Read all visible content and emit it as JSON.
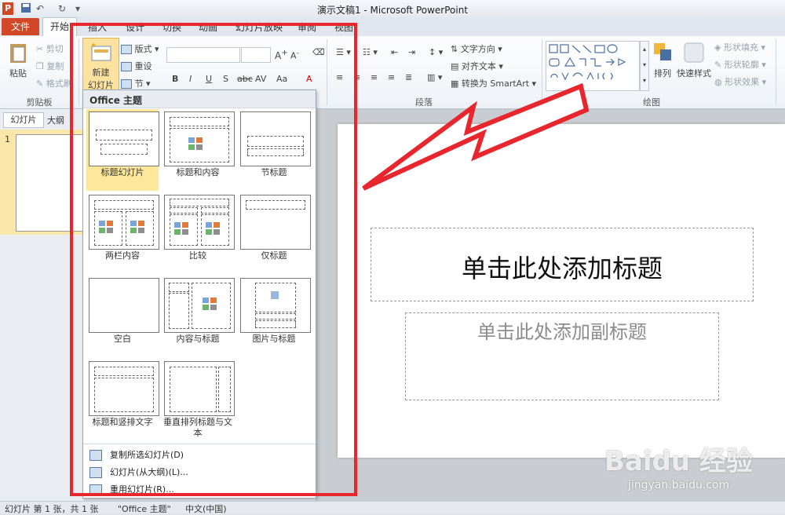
{
  "window": {
    "title": "演示文稿1 - Microsoft PowerPoint"
  },
  "tabs": [
    "文件",
    "开始",
    "插入",
    "设计",
    "切换",
    "动画",
    "幻灯片放映",
    "审阅",
    "视图"
  ],
  "ribbon": {
    "clipboard": {
      "paste": "粘贴",
      "cut": "剪切",
      "copy": "复制",
      "format_painter": "格式刷",
      "label": "剪贴板"
    },
    "slides": {
      "new_slide_line1": "新建",
      "new_slide_line2": "幻灯片",
      "layout": "版式",
      "reset": "重设",
      "section": "节"
    },
    "paragraph": {
      "text_direction": "文字方向",
      "align_text": "对齐文本",
      "smartart": "转换为 SmartArt",
      "label": "段落"
    },
    "drawing": {
      "arrange": "排列",
      "quick_styles": "快速样式",
      "shape_fill": "形状填充",
      "shape_outline": "形状轮廓",
      "shape_effects": "形状效果",
      "label": "绘图"
    },
    "font": {
      "bold": "B",
      "italic": "I",
      "underline": "U",
      "shadow": "S",
      "strike": "abc",
      "spacing": "AV",
      "case": "Aa",
      "color": "A"
    }
  },
  "left_panel": {
    "tab_slides": "幻灯片",
    "tab_outline": "大纲",
    "slide_number": "1"
  },
  "dropdown": {
    "header": "Office 主题",
    "layouts": [
      {
        "label": "标题幻灯片",
        "selected": true
      },
      {
        "label": "标题和内容",
        "selected": false
      },
      {
        "label": "节标题",
        "selected": false
      },
      {
        "label": "两栏内容",
        "selected": false
      },
      {
        "label": "比较",
        "selected": false
      },
      {
        "label": "仅标题",
        "selected": false
      },
      {
        "label": "空白",
        "selected": false
      },
      {
        "label": "内容与标题",
        "selected": false
      },
      {
        "label": "图片与标题",
        "selected": false
      },
      {
        "label": "标题和竖排文字",
        "selected": false
      },
      {
        "label": "垂直排列标题与文本",
        "selected": false
      }
    ],
    "menu": [
      "复制所选幻灯片(D)",
      "幻灯片(从大纲)(L)...",
      "重用幻灯片(R)..."
    ]
  },
  "slide": {
    "title_placeholder": "单击此处添加标题",
    "subtitle_placeholder": "单击此处添加副标题"
  },
  "status": {
    "slide_info": "幻灯片 第 1 张，共 1 张",
    "theme": "\"Office 主题\"",
    "language": "中文(中国)"
  },
  "watermark": {
    "brand": "Baidu 经验",
    "url": "jingyan.baidu.com"
  },
  "colors": {
    "file_tab": "#d24726",
    "highlight_box": "#e8262d",
    "selection": "#fde79a"
  }
}
